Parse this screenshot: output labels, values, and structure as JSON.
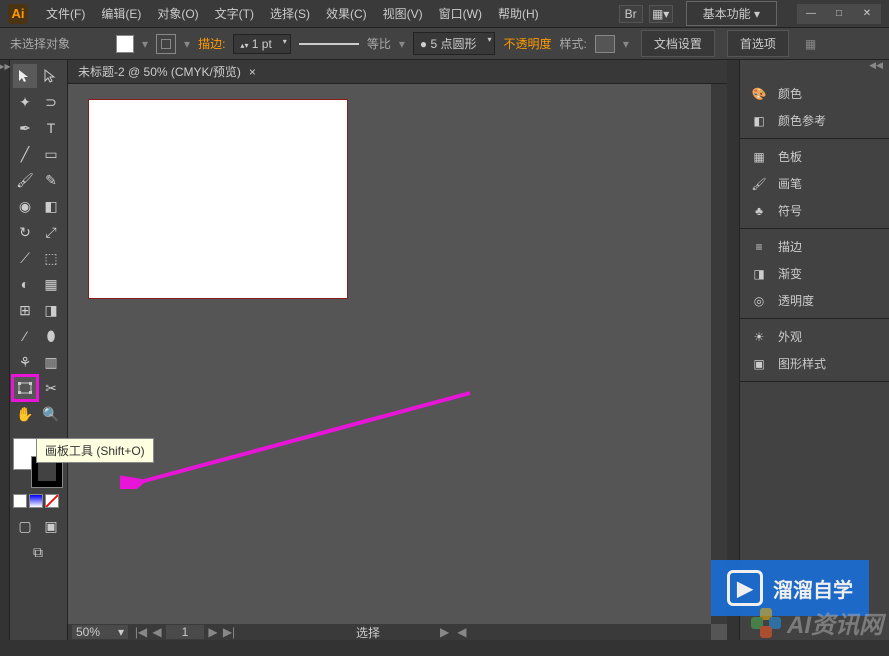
{
  "app": {
    "logo": "Ai"
  },
  "menu": {
    "items": [
      "文件(F)",
      "编辑(E)",
      "对象(O)",
      "文字(T)",
      "选择(S)",
      "效果(C)",
      "视图(V)",
      "窗口(W)",
      "帮助(H)"
    ],
    "workspace": "基本功能"
  },
  "options": {
    "no_selection": "未选择对象",
    "stroke_label": "描边:",
    "stroke_value": "1 pt",
    "uniform": "等比",
    "brush": "5 点圆形",
    "opacity": "不透明度",
    "style": "样式:",
    "doc_setup": "文档设置",
    "prefs": "首选项"
  },
  "document": {
    "tab": "未标题-2 @ 50% (CMYK/预览)",
    "close": "×",
    "zoom": "50%",
    "page": "1",
    "status": "选择"
  },
  "tooltip": "画板工具 (Shift+O)",
  "panels": {
    "group1": [
      {
        "icon": "palette",
        "label": "颜色"
      },
      {
        "icon": "guide",
        "label": "颜色参考"
      }
    ],
    "group2": [
      {
        "icon": "swatches",
        "label": "色板"
      },
      {
        "icon": "brushes",
        "label": "画笔"
      },
      {
        "icon": "symbols",
        "label": "符号"
      }
    ],
    "group3": [
      {
        "icon": "stroke",
        "label": "描边"
      },
      {
        "icon": "gradient",
        "label": "渐变"
      },
      {
        "icon": "transparency",
        "label": "透明度"
      }
    ],
    "group4": [
      {
        "icon": "appearance",
        "label": "外观"
      },
      {
        "icon": "graphic-styles",
        "label": "图形样式"
      }
    ]
  },
  "watermarks": {
    "brand1": "溜溜自学",
    "brand2": "AI资讯网"
  }
}
